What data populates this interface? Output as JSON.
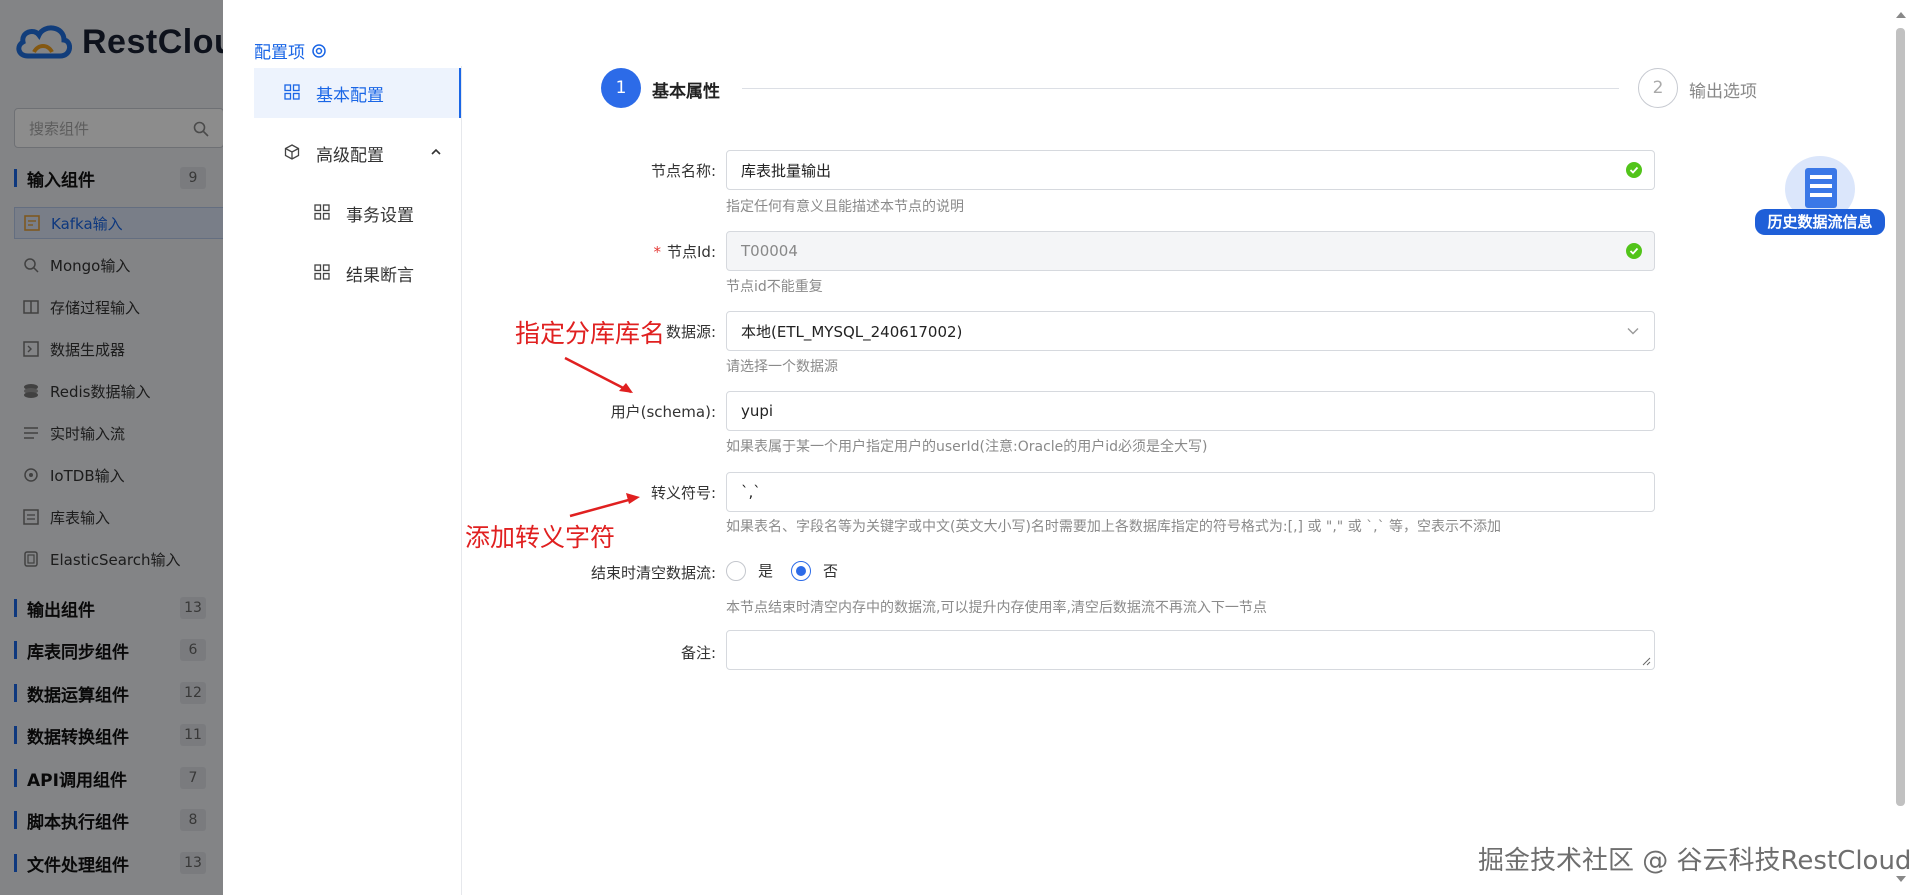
{
  "app": {
    "logo_text": "RestCloud"
  },
  "sidebar": {
    "search_placeholder": "搜索组件",
    "categories": [
      {
        "name": "输入组件",
        "count": "9"
      },
      {
        "name": "输出组件",
        "count": "13"
      },
      {
        "name": "库表同步组件",
        "count": "6"
      },
      {
        "name": "数据运算组件",
        "count": "12"
      },
      {
        "name": "数据转换组件",
        "count": "11"
      },
      {
        "name": "API调用组件",
        "count": "7"
      },
      {
        "name": "脚本执行组件",
        "count": "8"
      },
      {
        "name": "文件处理组件",
        "count": "13"
      }
    ],
    "components": [
      "Kafka输入",
      "Mongo输入",
      "存储过程输入",
      "数据生成器",
      "Redis数据输入",
      "实时输入流",
      "IoTDB输入",
      "库表输入",
      "ElasticSearch输入"
    ]
  },
  "config_nav": {
    "title": "配置项",
    "items": [
      {
        "label": "基本配置"
      },
      {
        "label": "高级配置"
      },
      {
        "label": "事务设置"
      },
      {
        "label": "结果断言"
      }
    ]
  },
  "steps": [
    {
      "num": "1",
      "label": "基本属性"
    },
    {
      "num": "2",
      "label": "输出选项"
    }
  ],
  "form": {
    "node_name": {
      "label": "节点名称:",
      "value": "库表批量输出",
      "hint": "指定任何有意义且能描述本节点的说明"
    },
    "node_id": {
      "required": "*",
      "label": "节点Id:",
      "value": "T00004",
      "hint": "节点id不能重复"
    },
    "datasource": {
      "label": "数据源:",
      "value": "本地(ETL_MYSQL_240617002)",
      "hint": "请选择一个数据源"
    },
    "schema": {
      "label": "用户(schema):",
      "value": "yupi",
      "hint": "如果表属于某一个用户指定用户的userId(注意:Oracle的用户id必须是全大写)"
    },
    "escape": {
      "label": "转义符号:",
      "value": "`,`",
      "hint": "如果表名、字段名等为关键字或中文(英文大小写)名时需要加上各数据库指定的符号格式为:[,] 或 \",\" 或 `,` 等，空表示不添加"
    },
    "clear_stream": {
      "label": "结束时清空数据流:",
      "yes": "是",
      "no": "否",
      "selected": "否",
      "hint": "本节点结束时清空内存中的数据流,可以提升内存使用率,清空后数据流不再流入下一节点"
    },
    "remark": {
      "label": "备注:",
      "value": ""
    }
  },
  "annotations": {
    "db_name": "指定分库库名",
    "escape_char": "添加转义字符"
  },
  "history_button": "历史数据流信息",
  "watermark": "掘金技术社区 @ 谷云科技RestCloud",
  "colors": {
    "primary": "#2c6be8",
    "annotation": "#e02020",
    "success": "#52c41a"
  }
}
